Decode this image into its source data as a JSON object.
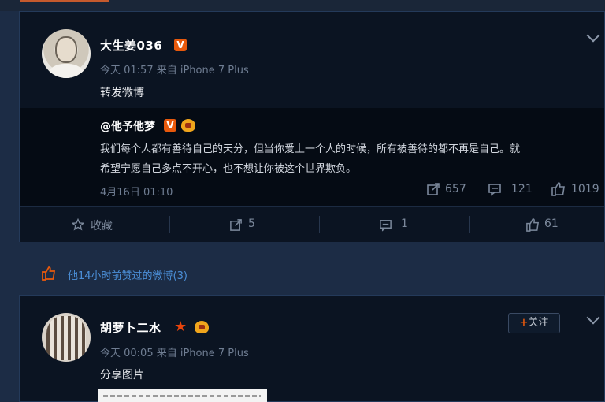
{
  "post1": {
    "author": "大生姜036",
    "meta": "今天 01:57 来自 iPhone 7 Plus",
    "text": "转发微博",
    "repost": {
      "author": "@他予他梦",
      "text_line1": "我们每个人都有善待自己的天分，但当你爱上一个人的时候，所有被善待的都不再是自己。就",
      "text_line2": "希望宁愿自己多点不开心，也不想让你被这个世界欺负。",
      "meta": "4月16日 01:10",
      "reposts": "657",
      "comments": "121",
      "likes": "1019"
    },
    "actions": {
      "favorite": "收藏",
      "repost_count": "5",
      "comment_count": "1",
      "like_count": "61"
    }
  },
  "liked_section": {
    "text": "他14小时前赞过的微博(3)"
  },
  "post2": {
    "author": "胡萝卜二水",
    "follow": "关注",
    "meta": "今天 00:05 来自 iPhone 7 Plus",
    "text": "分享图片"
  },
  "colors": {
    "accent": "#e8590c",
    "link": "#4b8fd8",
    "background": "#1c2c45",
    "card": "#0b1422"
  },
  "icons": {
    "verified": "v-badge-icon",
    "member": "crown-icon",
    "star": "star-icon",
    "dropdown": "chevron-down-icon",
    "repost": "repost-icon",
    "comment": "comment-icon",
    "like": "thumb-up-icon",
    "favorite": "star-outline-icon"
  }
}
